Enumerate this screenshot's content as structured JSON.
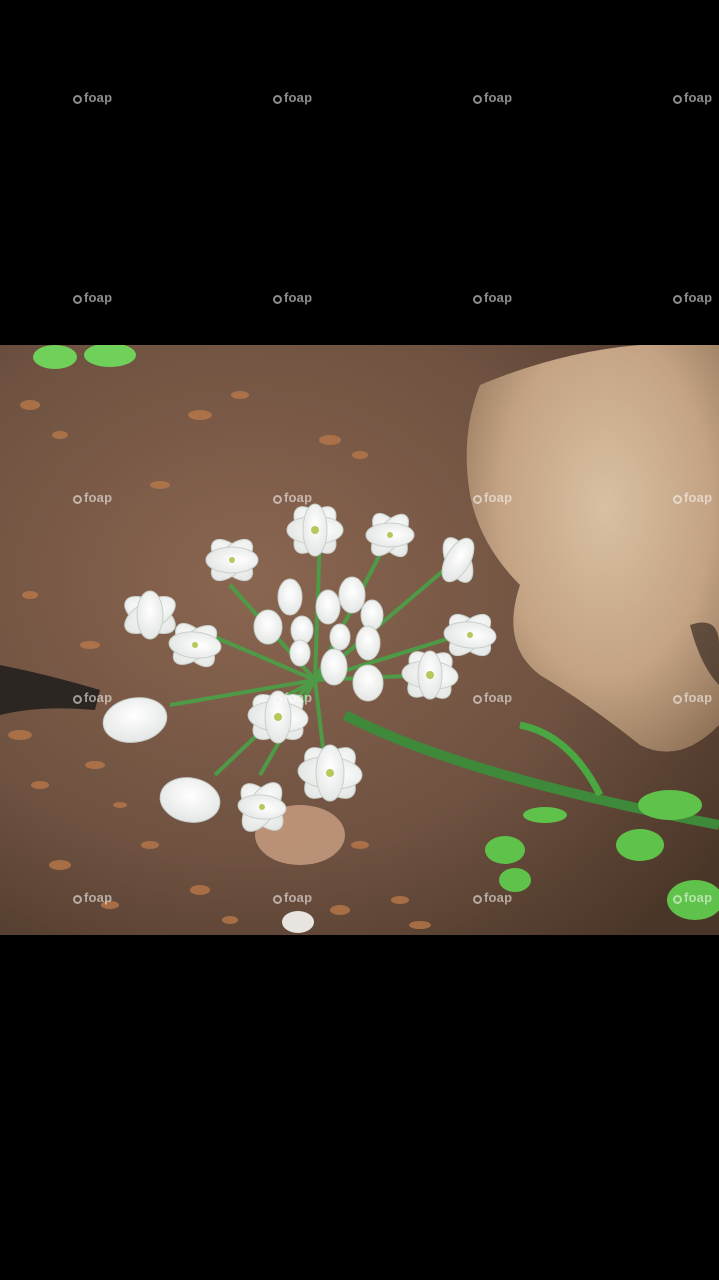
{
  "photo": {
    "subject": "white-allium-flower",
    "colors": {
      "soil": "#7a5a44",
      "rock": "#c9a98c",
      "petal": "#ffffff",
      "stem": "#3f8a3a",
      "leaf": "#5fc24a"
    }
  },
  "watermark": {
    "text": "foap"
  }
}
